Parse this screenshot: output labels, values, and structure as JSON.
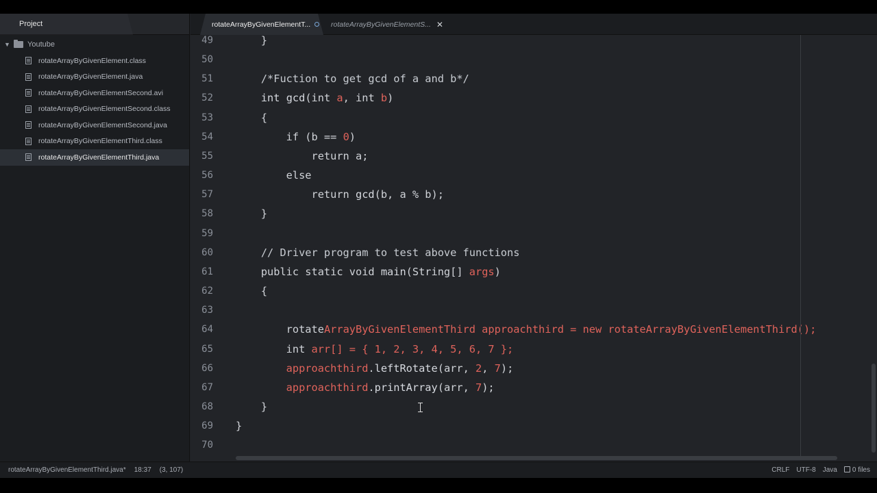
{
  "sidebar": {
    "tab_label": "Project",
    "folder": "Youtube",
    "files": [
      "rotateArrayByGivenElement.class",
      "rotateArrayByGivenElement.java",
      "rotateArrayByGivenElementSecond.avi",
      "rotateArrayByGivenElementSecond.class",
      "rotateArrayByGivenElementSecond.java",
      "rotateArrayByGivenElementThird.class",
      "rotateArrayByGivenElementThird.java"
    ],
    "active_file_index": 6
  },
  "tabs": [
    {
      "label": "rotateArrayByGivenElementT...",
      "modified": true
    },
    {
      "label": "rotateArrayByGivenElementS...",
      "modified": false
    }
  ],
  "editor": {
    "line_numbers": [
      "49",
      "50",
      "51",
      "52",
      "53",
      "54",
      "55",
      "56",
      "57",
      "58",
      "59",
      "60",
      "61",
      "62",
      "63",
      "64",
      "65",
      "66",
      "67",
      "68",
      "69",
      "70"
    ]
  },
  "status": {
    "file": "rotateArrayByGivenElementThird.java*",
    "position": "18:37",
    "selection": "(3, 107)",
    "line_ending": "CRLF",
    "encoding": "UTF-8",
    "grammar": "Java",
    "files": "0 files"
  },
  "colors": {
    "background": "#222428",
    "sidebar": "#1b1d20",
    "accent_red": "#e0635b"
  }
}
